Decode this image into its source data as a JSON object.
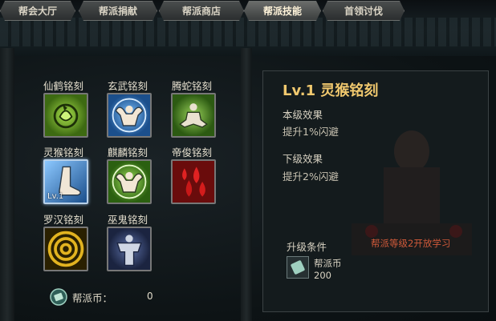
{
  "tabs": [
    {
      "label": "帮会大厅"
    },
    {
      "label": "帮派捐献"
    },
    {
      "label": "帮派商店"
    },
    {
      "label": "帮派技能"
    },
    {
      "label": "首领讨伐"
    }
  ],
  "active_tab_index": 3,
  "skills": [
    {
      "name": "仙鹤铭刻",
      "icon": "crane-icon",
      "color": "#5a8a1e"
    },
    {
      "name": "玄武铭刻",
      "icon": "muscle-man-icon",
      "color": "#2b79c4"
    },
    {
      "name": "腾蛇铭刻",
      "icon": "meditating-man-icon",
      "color": "#4e8a2a"
    },
    {
      "name": "灵猴铭刻",
      "icon": "foot-icon",
      "color": "#2f74c0",
      "level": "Lv.1",
      "selected": true
    },
    {
      "name": "麒麟铭刻",
      "icon": "muscle-man-icon",
      "color": "#3f8f2a"
    },
    {
      "name": "帝俊铭刻",
      "icon": "blood-drops-icon",
      "color": "#b31d1d"
    },
    {
      "name": "罗汉铭刻",
      "icon": "spiral-icon",
      "color": "#d8a91a"
    },
    {
      "name": "巫鬼铭刻",
      "icon": "undead-warrior-icon",
      "color": "#3b4c7a"
    }
  ],
  "currency": {
    "label": "帮派币：",
    "value": "0",
    "icon": "guild-coin-icon"
  },
  "detail": {
    "title": "Lv.1 灵猴铭刻",
    "current_effect_heading": "本级效果",
    "current_effect_text": "提升1%闪避",
    "next_effect_heading": "下级效果",
    "next_effect_text": "提升2%闪避",
    "upgrade_heading": "升级条件",
    "upgrade_note": "帮派等级2开放学习",
    "requirement_name": "帮派币",
    "requirement_amount": "200"
  }
}
